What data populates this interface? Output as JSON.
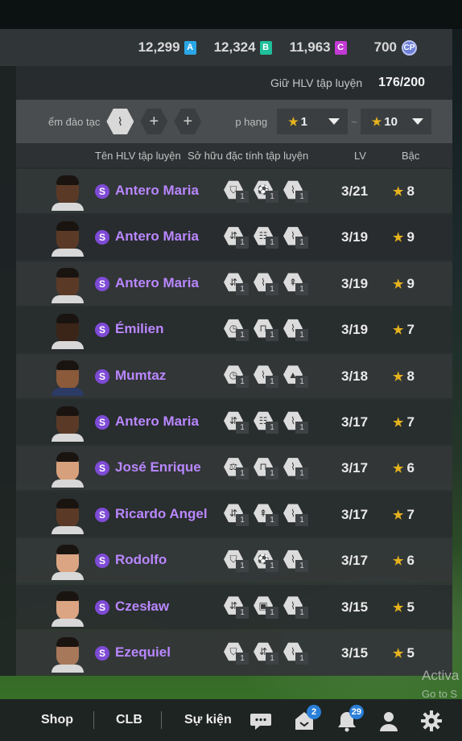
{
  "currencies": [
    {
      "amount": "12,299",
      "badge": "A",
      "color": "#2aa6e6"
    },
    {
      "amount": "12,324",
      "badge": "B",
      "color": "#1fbf9b"
    },
    {
      "amount": "11,963",
      "badge": "C",
      "color": "#c23ad4"
    },
    {
      "amount": "700",
      "badge": "CP",
      "color": "#6d7fd6",
      "icon": "coin-icon"
    }
  ],
  "hold": {
    "label": "Giữ HLV tập luyện",
    "value": "176/200"
  },
  "filter": {
    "label": "ểm đào tạc",
    "rank_label": "p hạng",
    "rank_from": "1",
    "rank_to": "10",
    "separator": "~",
    "add_symbol": "+"
  },
  "columns": {
    "name": "Tên HLV tập luyện",
    "traits": "Sở hữu đặc tính tập luyện",
    "lv": "LV",
    "grade": "Bậc"
  },
  "coaches": [
    {
      "name": "Antero Maria",
      "lv": "3/21",
      "grade": "8",
      "skin": "#5a3a26",
      "shirt": "#d8d8d8",
      "traits": [
        {
          "icon": "whistle-icon",
          "glyph": "⛉",
          "n": "1"
        },
        {
          "icon": "ball-icon",
          "glyph": "⚽",
          "n": "1"
        },
        {
          "icon": "boot-icon",
          "glyph": "⌇",
          "n": "1"
        }
      ]
    },
    {
      "name": "Antero Maria",
      "lv": "3/19",
      "grade": "9",
      "skin": "#5a3a26",
      "shirt": "#d8d8d8",
      "traits": [
        {
          "icon": "arrows-icon",
          "glyph": "⇵",
          "n": "1"
        },
        {
          "icon": "ladder-icon",
          "glyph": "☷",
          "n": "1"
        },
        {
          "icon": "boot-icon",
          "glyph": "⌇",
          "n": "1"
        }
      ]
    },
    {
      "name": "Antero Maria",
      "lv": "3/19",
      "grade": "9",
      "skin": "#5a3a26",
      "shirt": "#d8d8d8",
      "traits": [
        {
          "icon": "arrows-icon",
          "glyph": "⇵",
          "n": "1"
        },
        {
          "icon": "boot-icon",
          "glyph": "⌇",
          "n": "1"
        },
        {
          "icon": "cones-icon",
          "glyph": "⇞",
          "n": "1"
        }
      ]
    },
    {
      "name": "Émilien",
      "lv": "3/19",
      "grade": "7",
      "skin": "#3b2518",
      "shirt": "#d8d8d8",
      "traits": [
        {
          "icon": "stopwatch-icon",
          "glyph": "◷",
          "n": "1"
        },
        {
          "icon": "goal-icon",
          "glyph": "⊓",
          "n": "1"
        },
        {
          "icon": "boot-icon",
          "glyph": "⌇",
          "n": "1"
        }
      ]
    },
    {
      "name": "Mumtaz",
      "lv": "3/18",
      "grade": "8",
      "skin": "#8a5a3a",
      "shirt": "#2c3a66",
      "traits": [
        {
          "icon": "stopwatch-icon",
          "glyph": "◷",
          "n": "1"
        },
        {
          "icon": "boot-icon",
          "glyph": "⌇",
          "n": "1"
        },
        {
          "icon": "cone-icon",
          "glyph": "▲",
          "n": "1"
        }
      ]
    },
    {
      "name": "Antero Maria",
      "lv": "3/17",
      "grade": "7",
      "skin": "#5a3a26",
      "shirt": "#d8d8d8",
      "traits": [
        {
          "icon": "arrows-icon",
          "glyph": "⇵",
          "n": "1"
        },
        {
          "icon": "ladder-icon",
          "glyph": "☷",
          "n": "1"
        },
        {
          "icon": "boot-icon",
          "glyph": "⌇",
          "n": "1"
        }
      ]
    },
    {
      "name": "José Enrique",
      "lv": "3/17",
      "grade": "6",
      "skin": "#d7a07c",
      "shirt": "#d8d8d8",
      "traits": [
        {
          "icon": "dumbbell-icon",
          "glyph": "⚖",
          "n": "1"
        },
        {
          "icon": "goal-icon",
          "glyph": "⊓",
          "n": "1"
        },
        {
          "icon": "boot-icon",
          "glyph": "⌇",
          "n": "1"
        }
      ]
    },
    {
      "name": "Ricardo Angel",
      "lv": "3/17",
      "grade": "7",
      "skin": "#5a3a26",
      "shirt": "#d8d8d8",
      "traits": [
        {
          "icon": "arrows-icon",
          "glyph": "⇵",
          "n": "1"
        },
        {
          "icon": "cones-icon",
          "glyph": "⇞",
          "n": "1"
        },
        {
          "icon": "boot-icon",
          "glyph": "⌇",
          "n": "1"
        }
      ]
    },
    {
      "name": "Rodolfo",
      "lv": "3/17",
      "grade": "6",
      "skin": "#dba583",
      "shirt": "#d8d8d8",
      "traits": [
        {
          "icon": "whistle-icon",
          "glyph": "⛉",
          "n": "1"
        },
        {
          "icon": "ball-icon",
          "glyph": "⚽",
          "n": "1"
        },
        {
          "icon": "boot-icon",
          "glyph": "⌇",
          "n": "1"
        }
      ]
    },
    {
      "name": "Czesław",
      "lv": "3/15",
      "grade": "5",
      "skin": "#dba583",
      "shirt": "#d8d8d8",
      "traits": [
        {
          "icon": "arrows-icon",
          "glyph": "⇵",
          "n": "1"
        },
        {
          "icon": "lock-icon",
          "glyph": "▣",
          "n": "1"
        },
        {
          "icon": "boot-icon",
          "glyph": "⌇",
          "n": "1"
        }
      ]
    },
    {
      "name": "Ezequiel",
      "lv": "3/15",
      "grade": "5",
      "skin": "#a8785a",
      "shirt": "#d8d8d8",
      "traits": [
        {
          "icon": "whistle-icon",
          "glyph": "⛉",
          "n": "1"
        },
        {
          "icon": "arrows-icon",
          "glyph": "⇵",
          "n": "1"
        },
        {
          "icon": "boot-icon",
          "glyph": "⌇",
          "n": "1"
        }
      ]
    }
  ],
  "watermark": {
    "line1": "Activa",
    "line2": "Go to S"
  },
  "bottom_nav": {
    "shop": "Shop",
    "clb": "CLB",
    "events": "Sự kiện",
    "badge_2": "2",
    "badge_29": "29"
  }
}
